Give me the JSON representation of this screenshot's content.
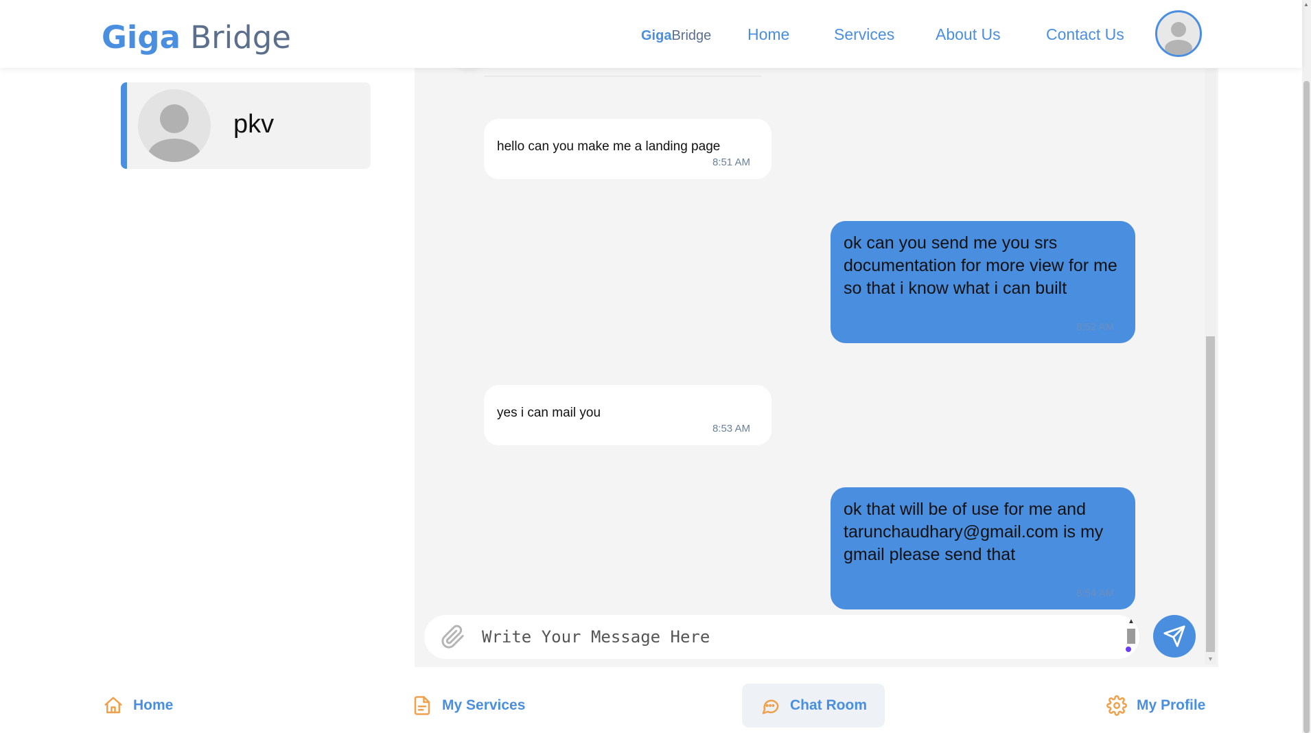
{
  "header": {
    "logo_part1": "Giga",
    "logo_part2": "Bridge",
    "nav_brand_part1": "Giga",
    "nav_brand_part2": "Bridge",
    "nav": [
      "Home",
      "Services",
      "About Us",
      "Contact Us"
    ]
  },
  "sidebar": {
    "contact_name": "pkv"
  },
  "chat": {
    "messages": [
      {
        "direction": "incoming",
        "text": "hello can you make me a landing page",
        "time": "8:51 AM"
      },
      {
        "direction": "outgoing",
        "text": "ok can you send me you srs documentation for more view for me so that i know what i can built",
        "time": "8:52 AM"
      },
      {
        "direction": "incoming",
        "text": "yes i can mail you",
        "time": "8:53 AM"
      },
      {
        "direction": "outgoing",
        "text": "ok that will be of use for me and tarunchaudhary@gmail.com is my gmail please send that",
        "time": "8:54 AM"
      }
    ],
    "composer_placeholder": "Write Your Message Here"
  },
  "bottom_nav": {
    "items": [
      "Home",
      "My Services",
      "Chat Room",
      "My Profile"
    ],
    "active": "Chat Room"
  },
  "colors": {
    "accent": "#4a8ee0",
    "icon_orange": "#f0a04b",
    "panel_bg": "#f4f4f4"
  },
  "icons": [
    "paperclip-icon",
    "send-icon",
    "home-icon",
    "document-icon",
    "chat-icon",
    "gear-icon",
    "user-avatar-icon"
  ]
}
